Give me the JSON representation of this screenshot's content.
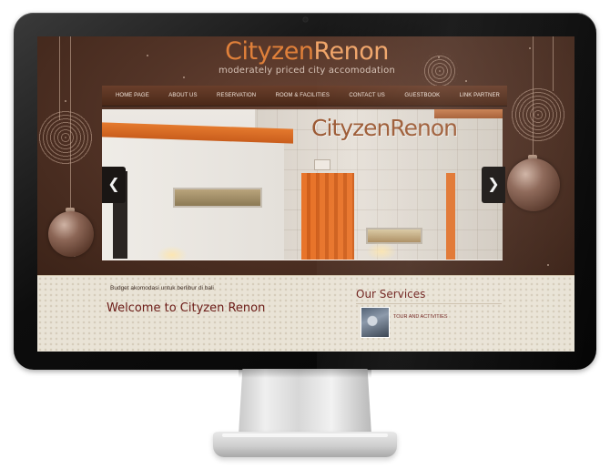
{
  "site": {
    "logo_part1": "Cityzen",
    "logo_part2": "Renon",
    "tagline": "moderately priced city accomodation"
  },
  "nav": {
    "items": [
      "HOME PAGE",
      "ABOUT US",
      "RESERVATION",
      "ROOM & FACILITIES",
      "CONTACT US",
      "GUESTBOOK",
      "LINK PARTNER"
    ]
  },
  "slider": {
    "sign_text": "CityzenRenon",
    "prev_arrow": "❮",
    "next_arrow": "❯"
  },
  "content": {
    "budget_text": "Budget akomodasi untuk berlibur di bali",
    "welcome_heading": "Welcome to Cityzen Renon",
    "services_heading": "Our Services",
    "services": [
      {
        "label": "TOUR AND ACTIVITIES",
        "icon": "rafting-photo"
      }
    ]
  },
  "colors": {
    "accent_orange": "#e0803a",
    "brand_maroon": "#6b1a16",
    "background_brown": "#4a2d21",
    "content_cream": "#e9e3d6"
  }
}
